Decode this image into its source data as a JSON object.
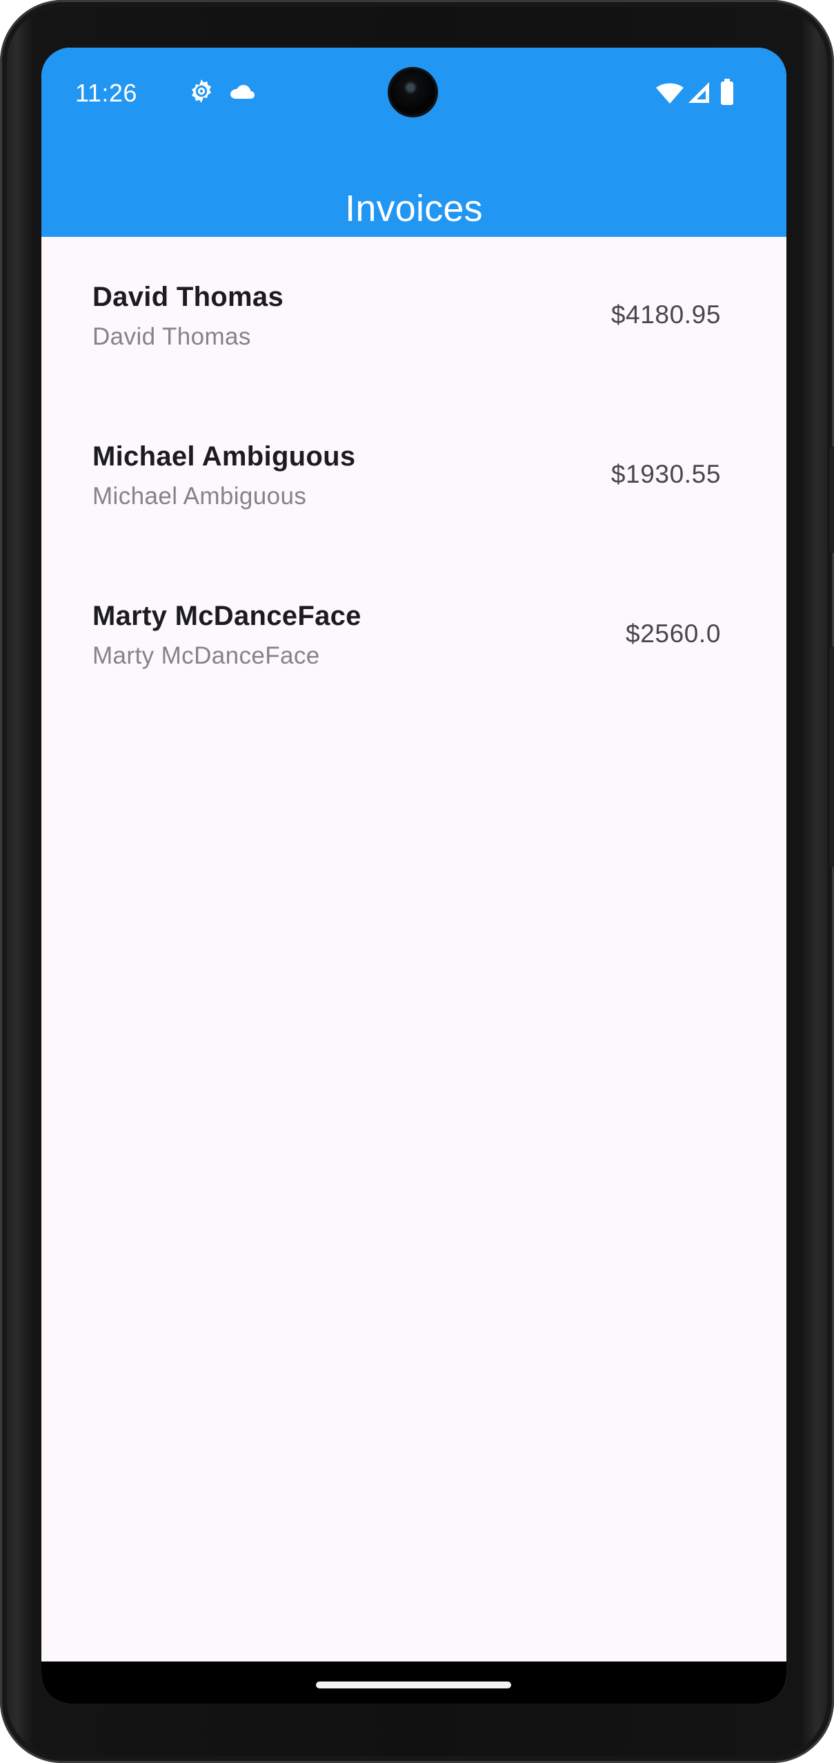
{
  "status_bar": {
    "time": "11:26",
    "icons": [
      "settings-icon",
      "cloud-icon",
      "wifi-icon",
      "cellular-signal-icon",
      "battery-icon"
    ]
  },
  "app_bar": {
    "title": "Invoices",
    "background_color": "#2196F3",
    "title_color": "#FFFFFF"
  },
  "invoices": [
    {
      "name": "David Thomas",
      "subtitle": "David Thomas",
      "amount": "$4180.95"
    },
    {
      "name": "Michael Ambiguous",
      "subtitle": "Michael Ambiguous",
      "amount": "$1930.55"
    },
    {
      "name": "Marty McDanceFace",
      "subtitle": "Marty McDanceFace",
      "amount": "$2560.0"
    }
  ],
  "theme": {
    "screen_background": "#FCF8FC",
    "primary_text": "#1C1B1F",
    "secondary_text": "#858385",
    "amount_text": "#48454E"
  }
}
